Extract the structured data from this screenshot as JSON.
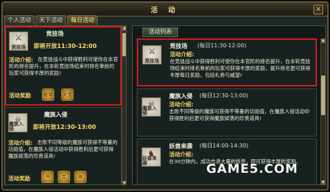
{
  "window": {
    "title": "活 动",
    "close_label": "×"
  },
  "tabs": [
    {
      "label": "个人活动"
    },
    {
      "label": "天下活动"
    },
    {
      "label": "每日活动"
    }
  ],
  "left": {
    "events": [
      {
        "name": "竞技场",
        "icon_text": "竞技场",
        "time": "即将开放11:30-12:00",
        "intro_label": "活动介绍:",
        "desc": "在竞技战斗中获得胜利可使你在本官阶的排名提升，在本轮竞技场结束时排名靠前的玩家可获得丰厚的奖励!",
        "reward_label": "活动奖励",
        "rewards": [
          "经验",
          "元宝"
        ]
      },
      {
        "name": "魔族入侵",
        "icon_text": "魔族入侵",
        "time": "即将开放12:30-13:00",
        "intro_label": "活动介绍:",
        "desc": "击败不同等级的魔族可获得不等量的功勋值，在魔族入侵活动中获得胜利后更可获得魔族掉落的珍贵道具!",
        "reward_label": "活动奖励",
        "rewards": [
          "书",
          "宝",
          "珠"
        ]
      }
    ]
  },
  "right": {
    "header": "活动列表",
    "events": [
      {
        "name": "竞技场",
        "icon_text": "竞技场",
        "time": "(每日11:30-12:00)",
        "intro_label": "活动介绍:",
        "desc": "在竞技战斗中获得胜利可使你在本官阶的排名提升，在本轮竞技场结束时排名靠前的玩家可获得丰厚的奖励，提升排名更可获得丰厚每日奖励，包括礼券与威望!"
      },
      {
        "name": "魔族入侵",
        "icon_text": "魔族入侵",
        "time": "(每日12:30-13:00)",
        "intro_label": "活动介绍:",
        "desc": "击败不同等级的魔族可获得不等量的功勋值，在魔族入侵活动中获得胜利后更可获得魔族掉落的珍贵道具!"
      },
      {
        "name": "妖兽来袭",
        "icon_text": "妖兽来袭",
        "time": "(每日14:00-14:30)",
        "intro_label": "活动介绍:",
        "desc": "在30分钟内，成功击退大量的妖兽，即可获得丰厚的奖励。"
      }
    ]
  },
  "watermark": "GAME5.COM"
}
